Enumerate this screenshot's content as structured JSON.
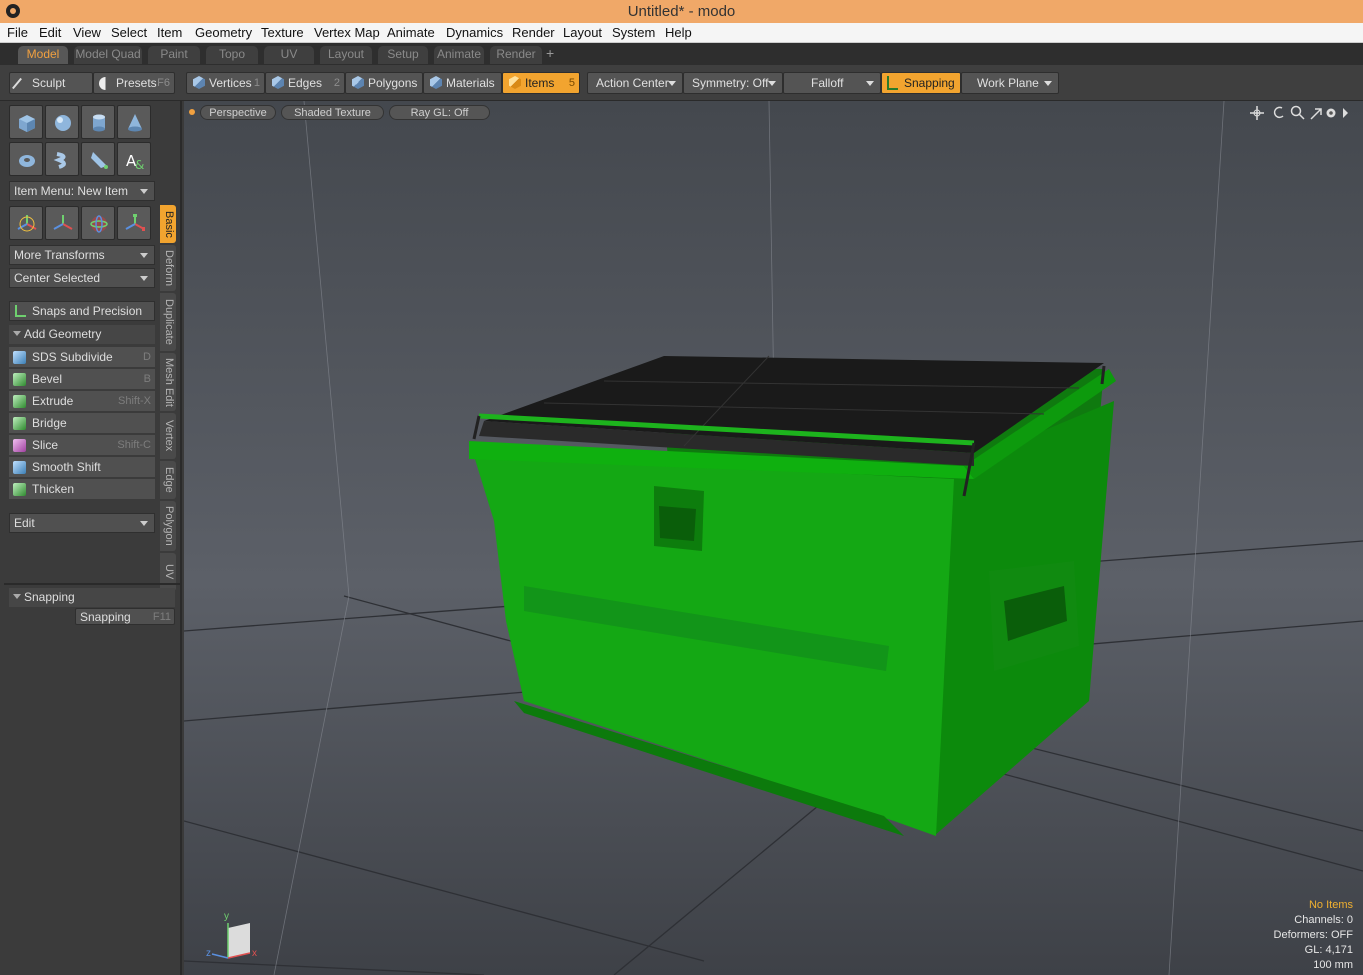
{
  "window": {
    "title": "Untitled* - modo"
  },
  "menu": [
    "File",
    "Edit",
    "View",
    "Select",
    "Item",
    "Geometry",
    "Texture",
    "Vertex Map",
    "Animate",
    "Dynamics",
    "Render",
    "Layout",
    "System",
    "Help"
  ],
  "layout_tabs": [
    "Model",
    "Model Quad",
    "Paint",
    "Topo",
    "UV",
    "Layout",
    "Setup",
    "Animate",
    "Render"
  ],
  "layout_tabs_add": "+",
  "toolbar": {
    "sculpt": "Sculpt",
    "presets": "Presets",
    "presets_key": "F6",
    "vertices": "Vertices",
    "vertices_key": "1",
    "edges": "Edges",
    "edges_key": "2",
    "polygons": "Polygons",
    "materials": "Materials",
    "items": "Items",
    "items_key": "5",
    "action_center": "Action Center",
    "symmetry": "Symmetry: Off",
    "falloff": "Falloff",
    "snapping": "Snapping",
    "work_plane": "Work Plane"
  },
  "side_tabs": [
    "Basic",
    "Deform",
    "Duplicate",
    "Mesh Edit",
    "Vertex",
    "Edge",
    "Polygon",
    "UV"
  ],
  "left": {
    "item_menu": "Item Menu: New Item",
    "more_transforms": "More Transforms",
    "center_selected": "Center Selected",
    "snaps_precision": "Snaps and Precision",
    "add_geometry": "Add Geometry",
    "tools": [
      {
        "label": "SDS Subdivide",
        "key": "D"
      },
      {
        "label": "Bevel",
        "key": "B"
      },
      {
        "label": "Extrude",
        "key": "Shift-X"
      },
      {
        "label": "Bridge",
        "key": ""
      },
      {
        "label": "Slice",
        "key": "Shift-C"
      },
      {
        "label": "Smooth Shift",
        "key": ""
      },
      {
        "label": "Thicken",
        "key": ""
      }
    ],
    "edit": "Edit",
    "snapping_header": "Snapping",
    "snapping_btn": "Snapping",
    "snapping_key": "F11"
  },
  "viewport": {
    "perspective": "Perspective",
    "shading": "Shaded Texture",
    "raygl": "Ray GL: Off",
    "axis": {
      "y": "y",
      "z": "z",
      "x": "x"
    },
    "stats": {
      "items": "No Items",
      "channels": "Channels: 0",
      "deformers": "Deformers: OFF",
      "gl": "GL: 4,171",
      "scale": "100 mm"
    }
  },
  "colors": {
    "accent": "#f2a42f",
    "title_bar": "#f0a868",
    "model_green": "#16a816"
  }
}
